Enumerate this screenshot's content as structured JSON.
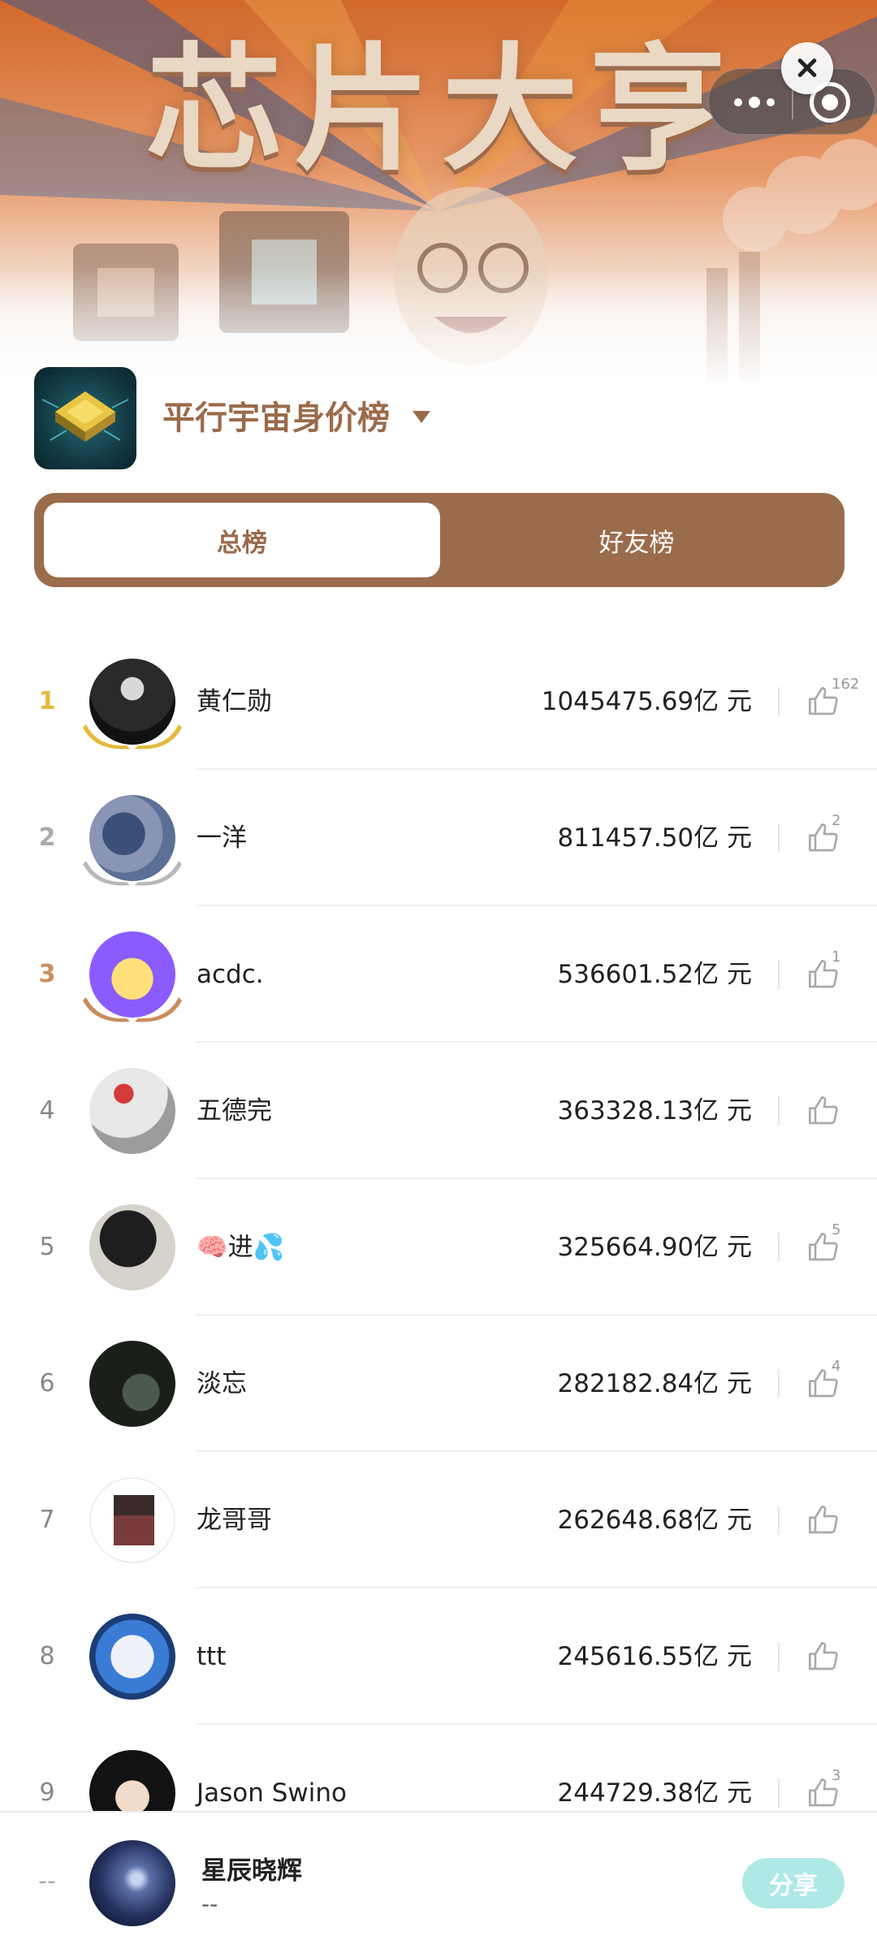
{
  "banner": {
    "title": "芯片大亨"
  },
  "header": {
    "board_title": "平行宇宙身价榜"
  },
  "tabs": [
    {
      "label": "总榜",
      "active": true
    },
    {
      "label": "好友榜",
      "active": false
    }
  ],
  "ranking": [
    {
      "rank": "1",
      "name": "黄仁勋",
      "value": "1045475.69亿 元",
      "likes": "162"
    },
    {
      "rank": "2",
      "name": "一洋",
      "value": "811457.50亿 元",
      "likes": "2"
    },
    {
      "rank": "3",
      "name": "acdc.",
      "value": "536601.52亿 元",
      "likes": "1"
    },
    {
      "rank": "4",
      "name": "五德完",
      "value": "363328.13亿 元",
      "likes": ""
    },
    {
      "rank": "5",
      "name": "🧠进💦",
      "value": "325664.90亿 元",
      "likes": "5"
    },
    {
      "rank": "6",
      "name": "淡忘",
      "value": "282182.84亿 元",
      "likes": "4"
    },
    {
      "rank": "7",
      "name": "龙哥哥",
      "value": "262648.68亿 元",
      "likes": ""
    },
    {
      "rank": "8",
      "name": "ttt",
      "value": "245616.55亿 元",
      "likes": ""
    },
    {
      "rank": "9",
      "name": "Jason Swino",
      "value": "244729.38亿 元",
      "likes": "3"
    }
  ],
  "self": {
    "rank": "--",
    "name": "星辰晓辉",
    "value": "--",
    "share_label": "分享"
  },
  "colors": {
    "brown": "#9b6c4c",
    "gold": "#e5b93a",
    "silver": "#a9a9a9",
    "bronze": "#c98d5e",
    "share": "#aee9e6"
  }
}
